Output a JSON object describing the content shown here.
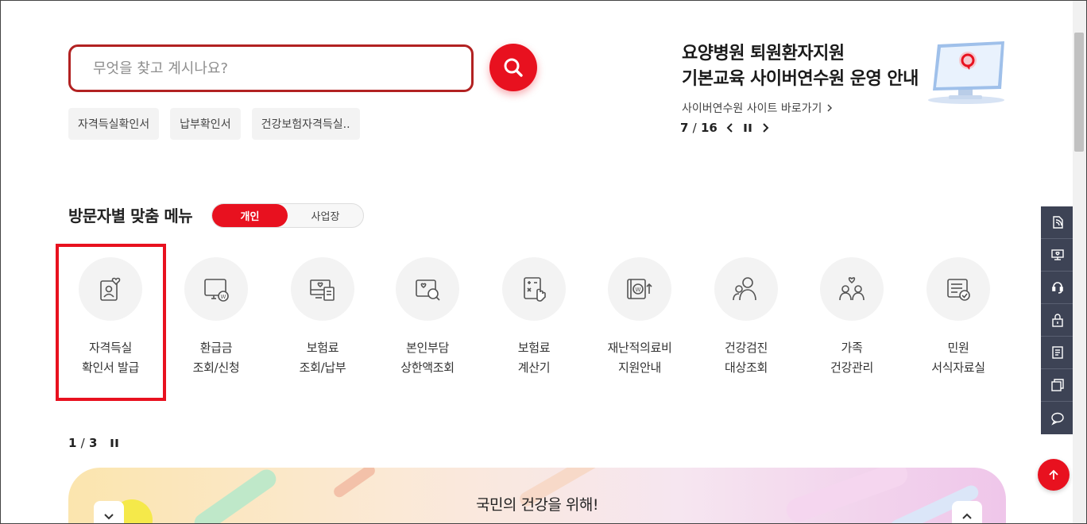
{
  "search": {
    "placeholder": "무엇을 찾고 계시나요?",
    "tags": [
      "자격득실확인서",
      "납부확인서",
      "건강보험자격득실.."
    ]
  },
  "promo": {
    "title_line1": "요양병원 퇴원환자지원",
    "title_line2": "기본교육 사이버연수원 운영 안내",
    "link": "사이버연수원 사이트 바로가기",
    "current": "7",
    "separator": "/",
    "total": "16"
  },
  "visitor_menu": {
    "title": "방문자별 맞춤 메뉴",
    "toggle": [
      "개인",
      "사업장"
    ],
    "active": "개인",
    "items": [
      {
        "line1": "자격득실",
        "line2": "확인서 발급",
        "icon": "id-card-heart-icon"
      },
      {
        "line1": "환급금",
        "line2": "조회/신청",
        "icon": "monitor-won-icon"
      },
      {
        "line1": "보험료",
        "line2": "조회/납부",
        "icon": "bill-heart-icon"
      },
      {
        "line1": "본인부담",
        "line2": "상한액조회",
        "icon": "search-heart-icon"
      },
      {
        "line1": "보험료",
        "line2": "계산기",
        "icon": "calculator-icon"
      },
      {
        "line1": "재난적의료비",
        "line2": "지원안내",
        "icon": "wallet-won-icon"
      },
      {
        "line1": "건강검진",
        "line2": "대상조회",
        "icon": "people-search-icon"
      },
      {
        "line1": "가족",
        "line2": "건강관리",
        "icon": "family-heart-icon"
      },
      {
        "line1": "민원",
        "line2": "서식자료실",
        "icon": "document-check-icon"
      }
    ],
    "pager_current": "1",
    "pager_total": "3"
  },
  "banner": {
    "text": "국민의 건강을 위해!"
  },
  "colors": {
    "accent": "#e8111f",
    "side_bar": "#3d4355"
  }
}
